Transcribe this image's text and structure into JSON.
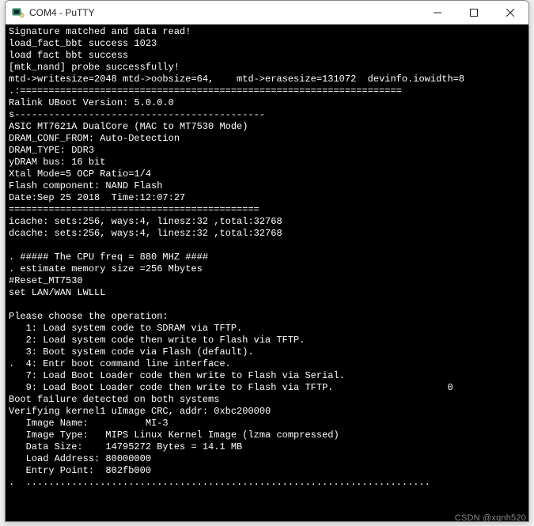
{
  "window": {
    "title": "COM4 - PuTTY"
  },
  "terminal": {
    "lines": [
      "Signature matched and data read!",
      "load_fact_bbt success 1023",
      "load fact bbt success",
      "[mtk_nand] probe successfully!",
      "mtd->writesize=2048 mtd->oobsize=64,    mtd->erasesize=131072  devinfo.iowidth=8",
      ".:===================================================================",
      "Ralink UBoot Version: 5.0.0.0",
      "s--------------------------------------------",
      "ASIC MT7621A DualCore (MAC to MT7530 Mode)",
      "DRAM_CONF_FROM: Auto-Detection",
      "DRAM_TYPE: DDR3",
      "yDRAM bus: 16 bit",
      "Xtal Mode=5 OCP Ratio=1/4",
      "Flash component: NAND Flash",
      "Date:Sep 25 2018  Time:12:07:27",
      "============================================",
      "icache: sets:256, ways:4, linesz:32 ,total:32768",
      "dcache: sets:256, ways:4, linesz:32 ,total:32768",
      "",
      ". ##### The CPU freq = 880 MHZ ####",
      ". estimate memory size =256 Mbytes",
      "#Reset_MT7530",
      "set LAN/WAN LWLLL",
      "",
      "Please choose the operation:",
      "   1: Load system code to SDRAM via TFTP.",
      "   2: Load system code then write to Flash via TFTP.",
      "   3: Boot system code via Flash (default).",
      ".  4: Entr boot command line interface.",
      "   7: Load Boot Loader code then write to Flash via Serial.",
      "   9: Load Boot Loader code then write to Flash via TFTP.                    0",
      "Boot failure detected on both systems",
      "Verifying kernel1 uImage CRC, addr: 0xbc200000",
      "   Image Name:          MI-3",
      "   Image Type:   MIPS Linux Kernel Image (lzma compressed)",
      "   Data Size:    14795272 Bytes = 14.1 MB",
      "   Load Address: 80000000",
      "   Entry Point:  802fb000",
      ".  .......................................................................",
      "",
      ""
    ]
  },
  "watermark": "CSDN @xqnh520"
}
